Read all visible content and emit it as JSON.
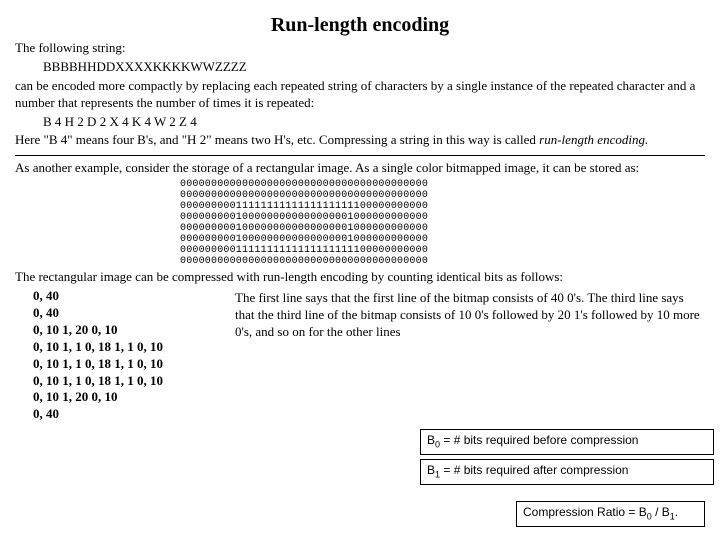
{
  "title": "Run-length encoding",
  "intro1": "The following string:",
  "example_string": "BBBBHHDDXXXXKKKKWWZZZZ",
  "intro2": "can be encoded more compactly by replacing each repeated string of characters by a single instance of the repeated character and a number that represents the number of times it is repeated:",
  "encoded_string": "B 4 H 2 D 2 X 4 K 4 W 2 Z 4",
  "intro3a": "Here \"B 4\" means four B's, and \"H 2\" means two H's, etc. Compressing a string in this way is called",
  "intro3b": "run-length encoding.",
  "storage_intro": "As another example, consider the storage of a rectangular image. As a single color bitmapped image, it can be stored as:",
  "bitmap_rows": [
    "0000000000000000000000000000000000000000",
    "0000000000000000000000000000000000000000",
    "0000000001111111111111111111100000000000",
    "0000000001000000000000000001000000000000",
    "0000000001000000000000000001000000000000",
    "0000000001000000000000000001000000000000",
    "0000000001111111111111111111100000000000",
    "0000000000000000000000000000000000000000"
  ],
  "compress_intro": "The rectangular image can be compressed with run-length encoding by counting identical bits as follows:",
  "rle_lines": [
    "0, 40",
    "0, 40",
    "0, 10 1, 20 0, 10",
    "0, 10 1, 1 0, 18 1, 1 0, 10",
    "0, 10 1, 1 0, 18 1, 1 0, 10",
    "0, 10 1, 1 0, 18 1, 1 0, 10",
    "0, 10 1, 20 0, 10",
    "0, 40"
  ],
  "explanation": "The first line says that the first line of the bitmap consists of 40 0's. The third line says that the third line of the bitmap consists of 10 0's followed by 20 1's followed by 10 more 0's, and so on for the other lines",
  "formula_b0": "B₀ = # bits required before compression",
  "formula_b1": "B₁ = # bits required after compression",
  "formula_ratio": "Compression Ratio = B₀ / B₁."
}
